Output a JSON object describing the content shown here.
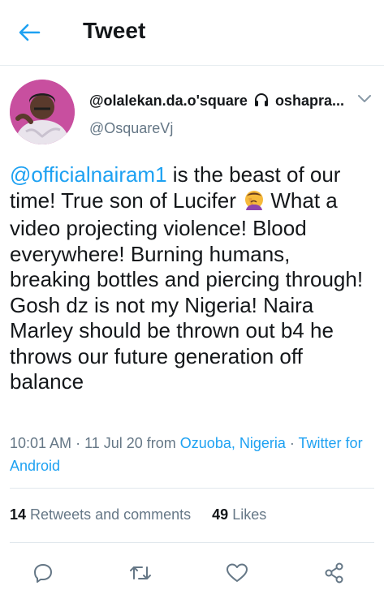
{
  "header": {
    "title": "Tweet",
    "back_icon": "arrow-left-icon",
    "accent": "#1da1f2"
  },
  "author": {
    "display_name_prefix": "@olalekan.da.o'square",
    "display_name_icon": "headphones-icon",
    "display_name_suffix": "oshapra...",
    "handle": "@OsquareVj",
    "avatar_color": "#c84f9f"
  },
  "tweet": {
    "mention": "@officialnairam1",
    "text_1": " is the beast of our time! True son of Lucifer",
    "emoji": "face-palm-emoji",
    "text_2": " What a video projecting violence! Blood everywhere! Burning humans, breaking bottles and piercing through! Gosh dz is not my Nigeria! Naira Marley should be thrown out b4 he throws our future generation off balance"
  },
  "meta": {
    "time": "10:01 AM",
    "sep1": " · ",
    "date": "11 Jul 20",
    "from": " from ",
    "location": "Ozuoba, Nigeria",
    "sep2": " · ",
    "source": "Twitter for Android"
  },
  "stats": {
    "retweets_count": "14",
    "retweets_label": "Retweets and comments",
    "likes_count": "49",
    "likes_label": "Likes"
  },
  "actions": [
    "reply-icon",
    "retweet-icon",
    "like-icon",
    "share-icon"
  ]
}
